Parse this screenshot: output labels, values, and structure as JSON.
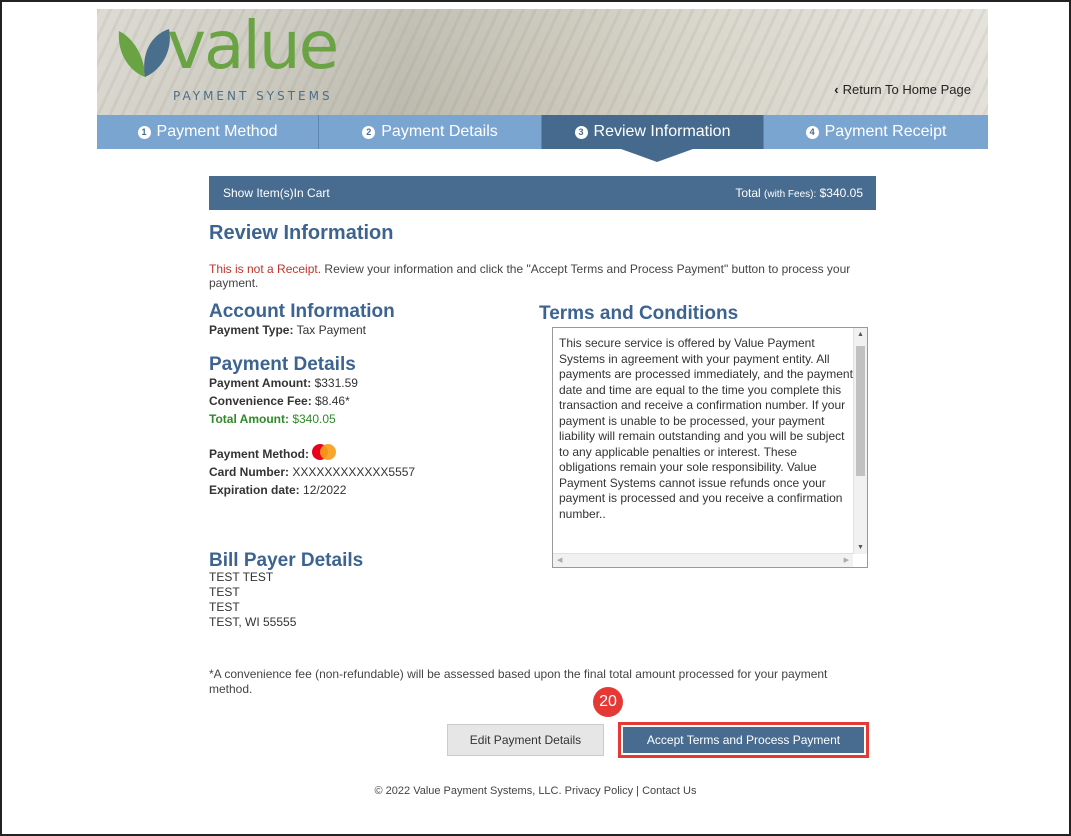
{
  "header": {
    "logo_word": "value",
    "logo_sub": "PAYMENT SYSTEMS",
    "return_link": "Return To Home Page"
  },
  "steps": [
    {
      "num": "1",
      "label": "Payment Method"
    },
    {
      "num": "2",
      "label": "Payment Details"
    },
    {
      "num": "3",
      "label": "Review Information"
    },
    {
      "num": "4",
      "label": "Payment Receipt"
    }
  ],
  "cart": {
    "show_items": "Show Item(s)In Cart",
    "total_label": "Total",
    "total_suffix": "(with Fees):",
    "total_value": "$340.05"
  },
  "review": {
    "title": "Review Information",
    "notice_red": "This is not a Receipt.",
    "notice_rest": " Review your information and click the \"Accept Terms and Process Payment\" button to process your payment."
  },
  "account": {
    "title": "Account Information",
    "payment_type_label": "Payment Type:",
    "payment_type_value": "Tax Payment"
  },
  "payment_details": {
    "title": "Payment Details",
    "amount_label": "Payment Amount:",
    "amount_value": "$331.59",
    "fee_label": "Convenience Fee:",
    "fee_value": "$8.46*",
    "total_label": "Total Amount:",
    "total_value": "$340.05",
    "method_label": "Payment Method:",
    "card_label": "Card Number:",
    "card_value": "XXXXXXXXXXXX5557",
    "exp_label": "Expiration date:",
    "exp_value": "12/2022"
  },
  "terms": {
    "title": "Terms and Conditions",
    "text": "This secure service is offered by Value Payment Systems in agreement with your payment entity. All payments are processed immediately, and the payment date and time are equal to the time you complete this transaction and receive a confirmation number. If your payment is unable to be processed, your payment liability will remain outstanding and you will be subject to any applicable penalties or interest. These obligations remain your sole responsibility. Value Payment Systems cannot issue refunds once your payment is processed and you receive a confirmation number.."
  },
  "bill_payer": {
    "title": "Bill Payer Details",
    "line1": "TEST TEST",
    "line2": "TEST",
    "line3": "TEST",
    "line4": "TEST, WI 55555"
  },
  "footnote": "*A convenience fee (non-refundable) will be assessed based upon the final total amount processed for your payment method.",
  "step_badge": "20",
  "buttons": {
    "edit": "Edit Payment Details",
    "accept": "Accept Terms and Process Payment"
  },
  "footer": {
    "copyright": "© 2022 Value Payment Systems, LLC.",
    "privacy": "Privacy Policy",
    "separator": "|",
    "contact": "Contact Us"
  },
  "colors": {
    "accent": "#476c90",
    "step_inactive": "#7ba5d1",
    "heading": "#3d6491",
    "logo_green": "#6aa343",
    "total_green": "#2e8b28",
    "notice_red": "#c0332a",
    "badge_red": "#e53935"
  }
}
